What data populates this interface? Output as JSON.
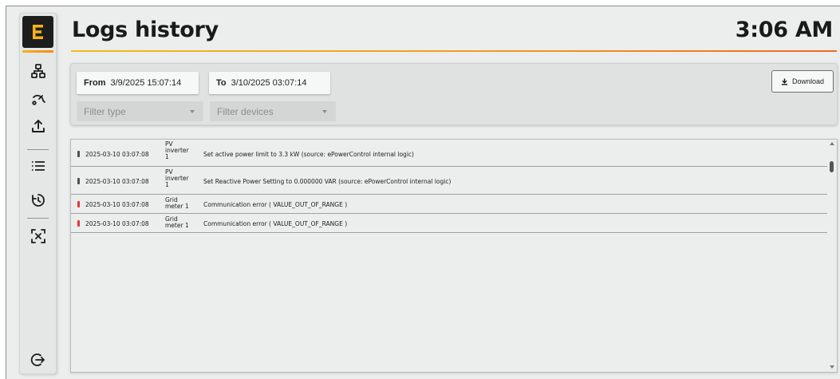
{
  "header": {
    "title": "Logs history",
    "clock": "3:06 AM"
  },
  "sidebar": {
    "logo": "E",
    "items": [
      {
        "icon": "topology-icon"
      },
      {
        "icon": "gauge-icon"
      },
      {
        "icon": "upload-icon"
      },
      {
        "icon": "list-icon"
      },
      {
        "icon": "history-icon"
      },
      {
        "icon": "scan-icon"
      },
      {
        "icon": "logout-icon"
      }
    ]
  },
  "filters": {
    "from_label": "From",
    "from_value": "3/9/2025 15:07:14",
    "to_label": "To",
    "to_value": "3/10/2025 03:07:14",
    "download_label": "Download",
    "filter_type_placeholder": "Filter type",
    "filter_devices_placeholder": "Filter devices"
  },
  "logs": [
    {
      "timestamp": "2025-03-10 03:07:08",
      "device_lines": [
        "PV",
        "inverter",
        "1"
      ],
      "message": "Set active power limit to 3.3 kW (source: ePowerControl internal logic)",
      "level_color": "#505050"
    },
    {
      "timestamp": "2025-03-10 03:07:08",
      "device_lines": [
        "PV",
        "inverter",
        "1"
      ],
      "message": "Set Reactive Power Setting to 0.000000 VAR (source: ePowerControl internal logic)",
      "level_color": "#505050"
    },
    {
      "timestamp": "2025-03-10 03:07:08",
      "device_lines": [
        "Grid",
        "meter 1"
      ],
      "message": "Communication error ( VALUE_OUT_OF_RANGE )",
      "level_color": "#e53935"
    },
    {
      "timestamp": "2025-03-10 03:07:08",
      "device_lines": [
        "Grid",
        "meter 1"
      ],
      "message": "Communication error ( VALUE_OUT_OF_RANGE )",
      "level_color": "#e53935"
    }
  ],
  "colors": {
    "accent_start": "#f4bb1e",
    "accent_end": "#ee6a1f",
    "error": "#e53935",
    "info": "#505050"
  }
}
